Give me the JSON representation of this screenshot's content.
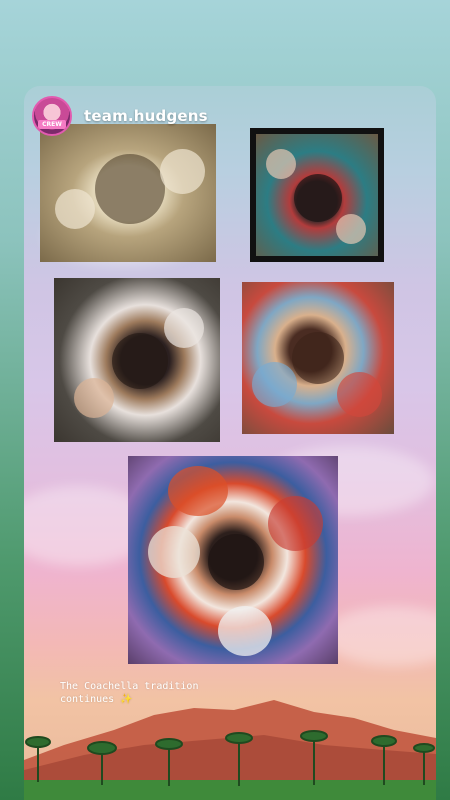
{
  "story": {
    "username": "team.hudgens",
    "avatar_tag": "CREW",
    "caption_line1": "The Coachella tradition",
    "caption_line2": "continues",
    "caption_emoji": "✨"
  },
  "colors": {
    "sky_top": "#aacfd6",
    "sky_bottom": "#e9b99b",
    "mountain": "#c35c45",
    "grass": "#3f8a3a",
    "avatar_ring": "#e25bb0"
  }
}
